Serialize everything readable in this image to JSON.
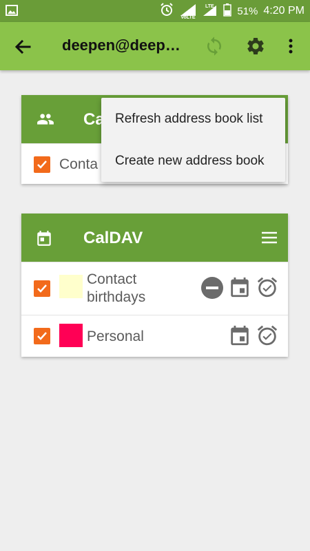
{
  "status_bar": {
    "battery": "51%",
    "time": "4:20 PM",
    "network": "VoLTE",
    "network_type": "LTE"
  },
  "toolbar": {
    "title": "deepen@deepen...",
    "icons": [
      "arrow-left-icon",
      "sync-icon",
      "gear-icon",
      "more-vert-icon"
    ]
  },
  "carddav": {
    "title": "CardDAV",
    "visible_title": "Ca",
    "items": [
      {
        "label": "Contacts",
        "visible_label": "Conta",
        "checked": true
      }
    ]
  },
  "caldav": {
    "title": "CalDAV",
    "items": [
      {
        "label": "Contact birthdays",
        "line1": "Contact",
        "line2": "birthdays",
        "color": "#ffffcc",
        "checked": true
      },
      {
        "label": "Personal",
        "color": "#ff0055",
        "checked": true
      }
    ]
  },
  "menu": {
    "items": [
      {
        "label": "Refresh address book list"
      },
      {
        "label": "Create new address book"
      }
    ]
  },
  "colors": {
    "status_bar": "#6a9c38",
    "toolbar": "#8bc34a",
    "card_header": "#689f38",
    "checkbox": "#f26a1b",
    "background": "#eeeeee"
  }
}
